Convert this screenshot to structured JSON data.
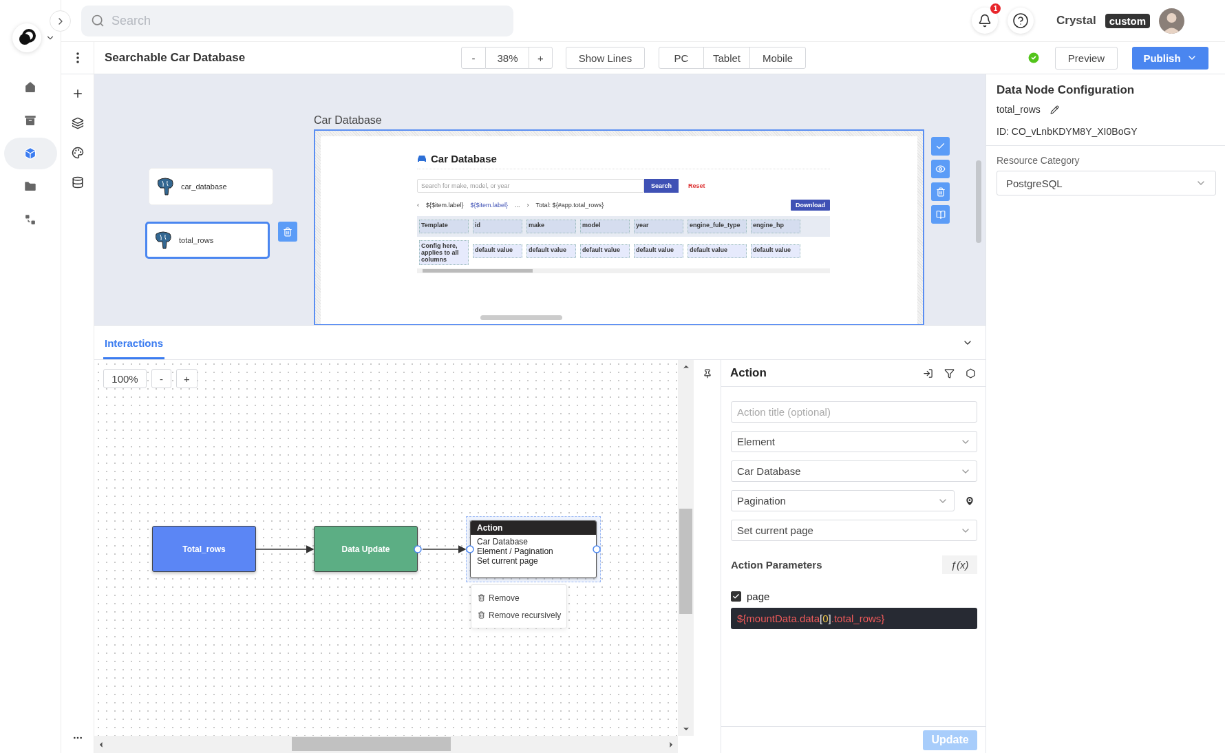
{
  "topbar": {
    "search": {
      "placeholder": "Search"
    },
    "notifications": "1",
    "user": {
      "name": "Crystal",
      "badge": "custom"
    }
  },
  "nav": [
    {
      "kind": "home",
      "selected": false
    },
    {
      "kind": "archive",
      "selected": false
    },
    {
      "kind": "cube",
      "selected": true
    },
    {
      "kind": "folder",
      "selected": false
    },
    {
      "kind": "tree",
      "selected": false
    }
  ],
  "toolbar": {
    "title": "Searchable Car Database",
    "zoom_out": "-",
    "zoom": "38%",
    "zoom_in": "+",
    "show_lines": "Show Lines",
    "devices": [
      {
        "label": "PC",
        "selected": false
      },
      {
        "label": "Tablet",
        "selected": false
      },
      {
        "label": "Mobile",
        "selected": false
      }
    ],
    "preview": "Preview",
    "publish": "Publish"
  },
  "canvas": {
    "data_nodes": [
      {
        "name": "car_database",
        "selected": false
      },
      {
        "name": "total_rows",
        "selected": true
      }
    ],
    "frame_label": "Car Database",
    "page": {
      "title": "Car Database",
      "search_placeholder": "Search for make, model, or year",
      "search": "Search",
      "reset": "Reset",
      "prev": "‹",
      "pages": [
        {
          "label": "${$item.label}",
          "selected": false
        },
        {
          "label": "${$item.label}",
          "selected": true
        }
      ],
      "ellipsis": "...",
      "next": "›",
      "total": "Total: ${#app.total_rows}",
      "download": "Download",
      "columns": [
        "Template",
        "id",
        "make",
        "model",
        "year",
        "engine_fule_type",
        "engine_hp"
      ],
      "row": [
        "Config here, applies to all columns",
        "default value",
        "default value",
        "default value",
        "default value",
        "default value",
        "default value"
      ]
    }
  },
  "interactions": {
    "tab": "Interactions",
    "zoom": "100%",
    "zoom_out": "-",
    "zoom_in": "+",
    "nodes": [
      {
        "kind": "trigger",
        "label": "Total_rows"
      },
      {
        "kind": "data",
        "label": "Data Update"
      },
      {
        "kind": "action",
        "title": "Action",
        "lines": [
          "Car Database",
          "Element / Pagination",
          "Set current page"
        ],
        "selected": true
      }
    ],
    "menu": [
      "Remove",
      "Remove recursively"
    ]
  },
  "action_panel": {
    "title": "Action",
    "title_placeholder": "Action title (optional)",
    "selects": [
      {
        "value": "Element",
        "pin": false
      },
      {
        "value": "Car Database",
        "pin": false
      },
      {
        "value": "Pagination",
        "pin": true
      },
      {
        "value": "Set current page",
        "pin": false
      }
    ],
    "params_title": "Action Parameters",
    "fx": "ƒ(x)",
    "params": [
      {
        "name": "page",
        "checked": true,
        "expression": [
          {
            "kind": "path",
            "text": "${mountData.data"
          },
          {
            "kind": "bracket",
            "text": "["
          },
          {
            "kind": "number",
            "text": "0"
          },
          {
            "kind": "bracket",
            "text": "]"
          },
          {
            "kind": "path",
            "text": ".total_rows}"
          }
        ]
      }
    ],
    "update": {
      "label": "Update",
      "disabled": true
    }
  },
  "config": {
    "title": "Data Node Configuration",
    "node_name": "total_rows",
    "id": "ID: CO_vLnbKDYM8Y_XI0BoGY",
    "resource_label": "Resource Category",
    "resource_value": "PostgreSQL"
  }
}
